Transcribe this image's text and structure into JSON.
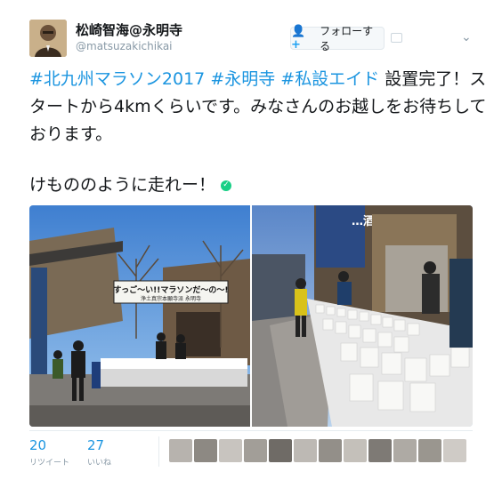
{
  "user": {
    "display_name": "松崎智海@永明寺",
    "handle": "@matsuzakichikai"
  },
  "follow_button": {
    "label": "フォローする"
  },
  "tweet": {
    "hashtags": [
      "#北九州マラソン2017",
      "#永明寺",
      "#私設エイド"
    ],
    "body_line1_tail": "設",
    "body_rest": "置完了！スタートから4kmくらいです。みなさんのお越しをお待ちしております。",
    "second_paragraph": "けもののように走れー！"
  },
  "photo_banner": {
    "main": "すっご〜い!!マラソンだ〜の〜!",
    "sub": "浄土真宗本願寺派 永明寺"
  },
  "photo_sign": "…酒屋",
  "stats": {
    "retweets": {
      "count": "20",
      "label": "リツイート"
    },
    "likes": {
      "count": "27",
      "label": "いいね"
    }
  },
  "colors": {
    "link": "#1b95e0",
    "secondary_text": "#8899a6",
    "verified_green": "#19cf86"
  }
}
